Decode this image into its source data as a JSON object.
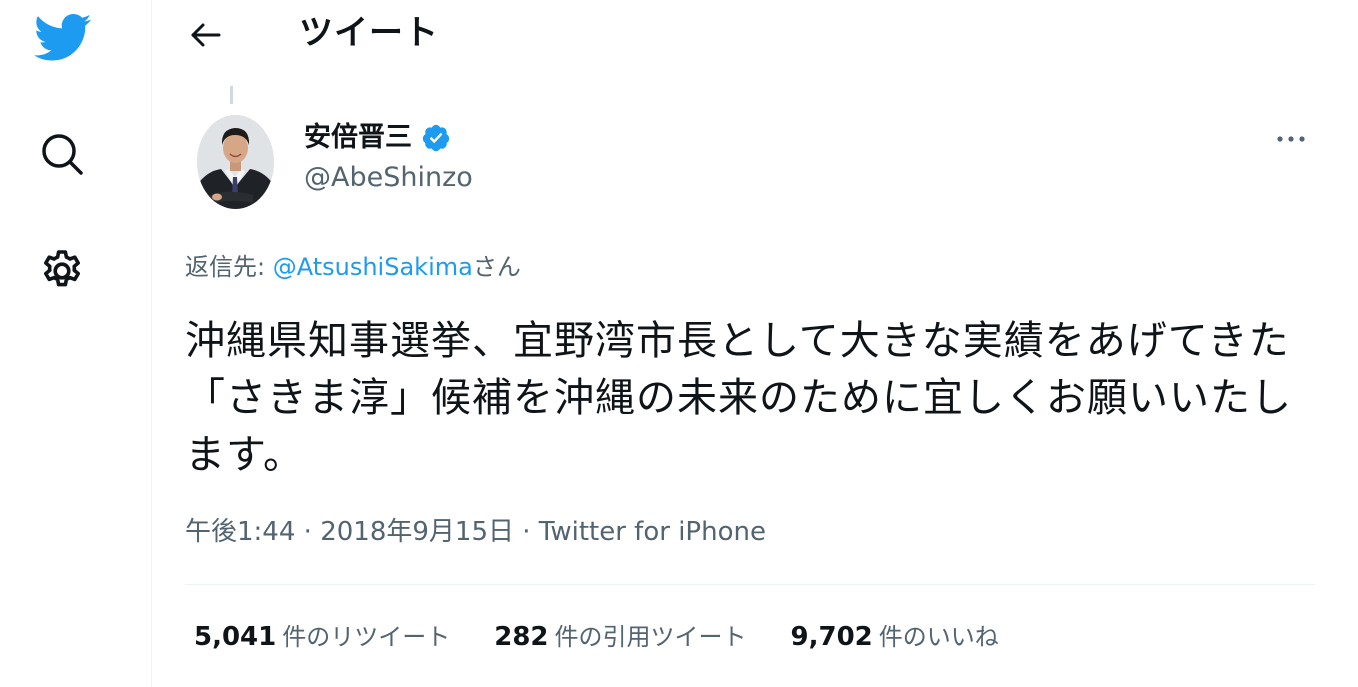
{
  "header": {
    "title": "ツイート"
  },
  "icons": {
    "logo": "twitter-bird-icon",
    "search": "search-icon",
    "settings": "gear-icon",
    "back": "back-arrow-icon",
    "more": "more-dots-icon",
    "verified": "verified-badge-icon"
  },
  "colors": {
    "brand": "#1d9bf0",
    "text": "#0f1419",
    "secondary": "#536471"
  },
  "tweet": {
    "author": {
      "name": "安倍晋三",
      "handle": "@AbeShinzo"
    },
    "reply_prefix": "返信先: ",
    "reply_to": "@AtsushiSakima",
    "reply_suffix": "さん",
    "text": "沖縄県知事選挙、宜野湾市長として大きな実績をあげてきた「さきま淳」候補を沖縄の未来のために宜しくお願いいたします。",
    "time": "午後1:44",
    "separator": " · ",
    "date": "2018年9月15日",
    "source": "Twitter for iPhone"
  },
  "stats": {
    "retweets_count": "5,041",
    "retweets_label": "件のリツイート",
    "quotes_count": "282",
    "quotes_label": "件の引用ツイート",
    "likes_count": "9,702",
    "likes_label": "件のいいね"
  }
}
